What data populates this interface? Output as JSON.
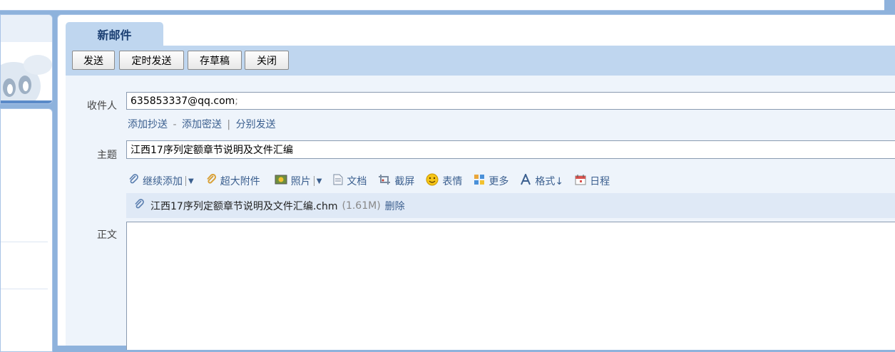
{
  "compose": {
    "tab_title": "新邮件",
    "toolbar": {
      "send": "发送",
      "scheduled_send": "定时发送",
      "save_draft": "存草稿",
      "close": "关闭"
    },
    "to_label": "收件人",
    "to_value": "635853337@qq.com",
    "to_separator": ";",
    "add_cc": "添加抄送",
    "add_bcc": "添加密送",
    "separate_send": "分别发送",
    "link_dash": "-",
    "link_pipe": "|",
    "subject_label": "主题",
    "subject_value": "江西17序列定额章节说明及文件汇编",
    "tools": {
      "continue_add": "继续添加",
      "large_attachment": "超大附件",
      "photo": "照片",
      "document": "文档",
      "screenshot": "截屏",
      "emoji": "表情",
      "more": "更多",
      "format": "格式↓",
      "schedule": "日程"
    },
    "attachment": {
      "name": "江西17序列定额章节说明及文件汇编.chm",
      "size": "(1.61M)",
      "delete": "删除"
    },
    "body_label": "正文"
  },
  "colors": {
    "toolbar_bg": "#bfd6ef",
    "compose_bg": "#eef4fb",
    "link": "#3b5f8f",
    "tab_text": "#1b3f73"
  },
  "icons": [
    "paperclip-icon",
    "large-attachment-icon",
    "photo-icon",
    "document-icon",
    "screenshot-icon",
    "emoji-icon",
    "more-icon",
    "format-icon",
    "calendar-icon"
  ]
}
